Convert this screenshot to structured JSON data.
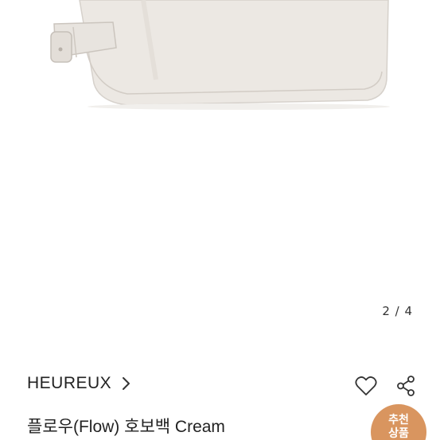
{
  "gallery": {
    "current": 2,
    "total": 4,
    "counter_text": "2 / 4"
  },
  "product": {
    "brand": "HEUREUX",
    "title": "플로우(Flow) 호보백 Cream"
  },
  "actions": {
    "like_icon": "heart-icon",
    "share_icon": "share-icon"
  },
  "badge": {
    "line1": "추천",
    "line2": "상품"
  },
  "colors": {
    "bag": "#ece8e3",
    "badge": "#d9955f",
    "text": "#222222"
  }
}
